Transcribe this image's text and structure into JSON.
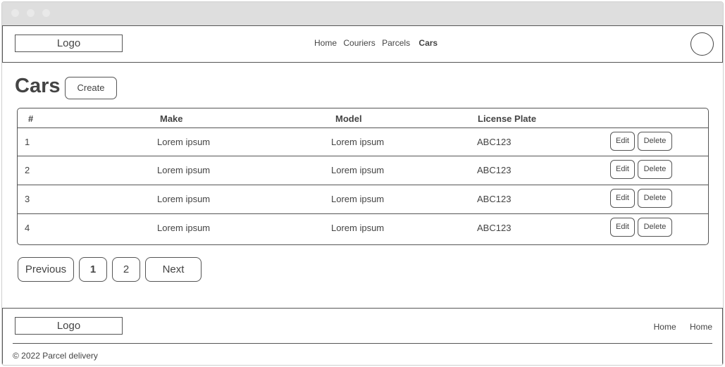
{
  "header": {
    "logo": "Logo",
    "nav": [
      "Home",
      "Couriers",
      "Parcels",
      "Cars"
    ],
    "active_nav": "Cars"
  },
  "main": {
    "title": "Cars",
    "create_label": "Create",
    "table": {
      "columns": [
        "#",
        "Make",
        "Model",
        "License Plate"
      ],
      "rows": [
        {
          "num": "1",
          "make": "Lorem ipsum",
          "model": "Lorem ipsum",
          "plate": "ABC123"
        },
        {
          "num": "2",
          "make": "Lorem ipsum",
          "model": "Lorem ipsum",
          "plate": "ABC123"
        },
        {
          "num": "3",
          "make": "Lorem ipsum",
          "model": "Lorem ipsum",
          "plate": "ABC123"
        },
        {
          "num": "4",
          "make": "Lorem ipsum",
          "model": "Lorem ipsum",
          "plate": "ABC123"
        }
      ],
      "edit_label": "Edit",
      "delete_label": "Delete"
    },
    "pagination": {
      "previous": "Previous",
      "pages": [
        "1",
        "2"
      ],
      "current_page": "1",
      "next": "Next"
    }
  },
  "footer": {
    "logo": "Logo",
    "links": [
      "Home",
      "Home"
    ],
    "copyright": "© 2022 Parcel delivery"
  }
}
